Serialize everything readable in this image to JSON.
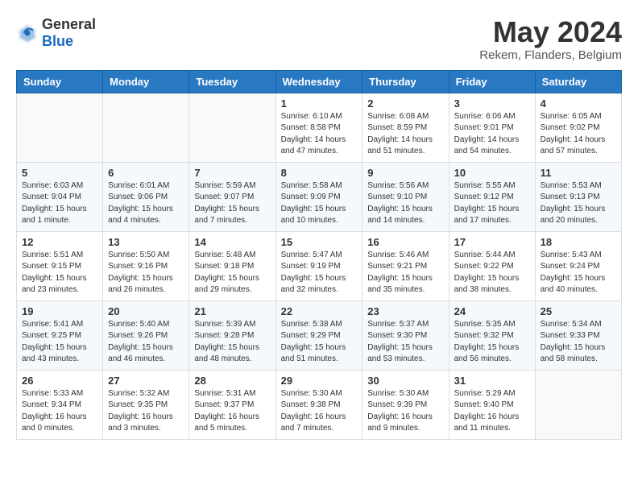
{
  "logo": {
    "general": "General",
    "blue": "Blue"
  },
  "title": {
    "month_year": "May 2024",
    "location": "Rekem, Flanders, Belgium"
  },
  "headers": [
    "Sunday",
    "Monday",
    "Tuesday",
    "Wednesday",
    "Thursday",
    "Friday",
    "Saturday"
  ],
  "weeks": [
    [
      {
        "day": "",
        "content": ""
      },
      {
        "day": "",
        "content": ""
      },
      {
        "day": "",
        "content": ""
      },
      {
        "day": "1",
        "content": "Sunrise: 6:10 AM\nSunset: 8:58 PM\nDaylight: 14 hours\nand 47 minutes."
      },
      {
        "day": "2",
        "content": "Sunrise: 6:08 AM\nSunset: 8:59 PM\nDaylight: 14 hours\nand 51 minutes."
      },
      {
        "day": "3",
        "content": "Sunrise: 6:06 AM\nSunset: 9:01 PM\nDaylight: 14 hours\nand 54 minutes."
      },
      {
        "day": "4",
        "content": "Sunrise: 6:05 AM\nSunset: 9:02 PM\nDaylight: 14 hours\nand 57 minutes."
      }
    ],
    [
      {
        "day": "5",
        "content": "Sunrise: 6:03 AM\nSunset: 9:04 PM\nDaylight: 15 hours\nand 1 minute."
      },
      {
        "day": "6",
        "content": "Sunrise: 6:01 AM\nSunset: 9:06 PM\nDaylight: 15 hours\nand 4 minutes."
      },
      {
        "day": "7",
        "content": "Sunrise: 5:59 AM\nSunset: 9:07 PM\nDaylight: 15 hours\nand 7 minutes."
      },
      {
        "day": "8",
        "content": "Sunrise: 5:58 AM\nSunset: 9:09 PM\nDaylight: 15 hours\nand 10 minutes."
      },
      {
        "day": "9",
        "content": "Sunrise: 5:56 AM\nSunset: 9:10 PM\nDaylight: 15 hours\nand 14 minutes."
      },
      {
        "day": "10",
        "content": "Sunrise: 5:55 AM\nSunset: 9:12 PM\nDaylight: 15 hours\nand 17 minutes."
      },
      {
        "day": "11",
        "content": "Sunrise: 5:53 AM\nSunset: 9:13 PM\nDaylight: 15 hours\nand 20 minutes."
      }
    ],
    [
      {
        "day": "12",
        "content": "Sunrise: 5:51 AM\nSunset: 9:15 PM\nDaylight: 15 hours\nand 23 minutes."
      },
      {
        "day": "13",
        "content": "Sunrise: 5:50 AM\nSunset: 9:16 PM\nDaylight: 15 hours\nand 26 minutes."
      },
      {
        "day": "14",
        "content": "Sunrise: 5:48 AM\nSunset: 9:18 PM\nDaylight: 15 hours\nand 29 minutes."
      },
      {
        "day": "15",
        "content": "Sunrise: 5:47 AM\nSunset: 9:19 PM\nDaylight: 15 hours\nand 32 minutes."
      },
      {
        "day": "16",
        "content": "Sunrise: 5:46 AM\nSunset: 9:21 PM\nDaylight: 15 hours\nand 35 minutes."
      },
      {
        "day": "17",
        "content": "Sunrise: 5:44 AM\nSunset: 9:22 PM\nDaylight: 15 hours\nand 38 minutes."
      },
      {
        "day": "18",
        "content": "Sunrise: 5:43 AM\nSunset: 9:24 PM\nDaylight: 15 hours\nand 40 minutes."
      }
    ],
    [
      {
        "day": "19",
        "content": "Sunrise: 5:41 AM\nSunset: 9:25 PM\nDaylight: 15 hours\nand 43 minutes."
      },
      {
        "day": "20",
        "content": "Sunrise: 5:40 AM\nSunset: 9:26 PM\nDaylight: 15 hours\nand 46 minutes."
      },
      {
        "day": "21",
        "content": "Sunrise: 5:39 AM\nSunset: 9:28 PM\nDaylight: 15 hours\nand 48 minutes."
      },
      {
        "day": "22",
        "content": "Sunrise: 5:38 AM\nSunset: 9:29 PM\nDaylight: 15 hours\nand 51 minutes."
      },
      {
        "day": "23",
        "content": "Sunrise: 5:37 AM\nSunset: 9:30 PM\nDaylight: 15 hours\nand 53 minutes."
      },
      {
        "day": "24",
        "content": "Sunrise: 5:35 AM\nSunset: 9:32 PM\nDaylight: 15 hours\nand 56 minutes."
      },
      {
        "day": "25",
        "content": "Sunrise: 5:34 AM\nSunset: 9:33 PM\nDaylight: 15 hours\nand 58 minutes."
      }
    ],
    [
      {
        "day": "26",
        "content": "Sunrise: 5:33 AM\nSunset: 9:34 PM\nDaylight: 16 hours\nand 0 minutes."
      },
      {
        "day": "27",
        "content": "Sunrise: 5:32 AM\nSunset: 9:35 PM\nDaylight: 16 hours\nand 3 minutes."
      },
      {
        "day": "28",
        "content": "Sunrise: 5:31 AM\nSunset: 9:37 PM\nDaylight: 16 hours\nand 5 minutes."
      },
      {
        "day": "29",
        "content": "Sunrise: 5:30 AM\nSunset: 9:38 PM\nDaylight: 16 hours\nand 7 minutes."
      },
      {
        "day": "30",
        "content": "Sunrise: 5:30 AM\nSunset: 9:39 PM\nDaylight: 16 hours\nand 9 minutes."
      },
      {
        "day": "31",
        "content": "Sunrise: 5:29 AM\nSunset: 9:40 PM\nDaylight: 16 hours\nand 11 minutes."
      },
      {
        "day": "",
        "content": ""
      }
    ]
  ]
}
